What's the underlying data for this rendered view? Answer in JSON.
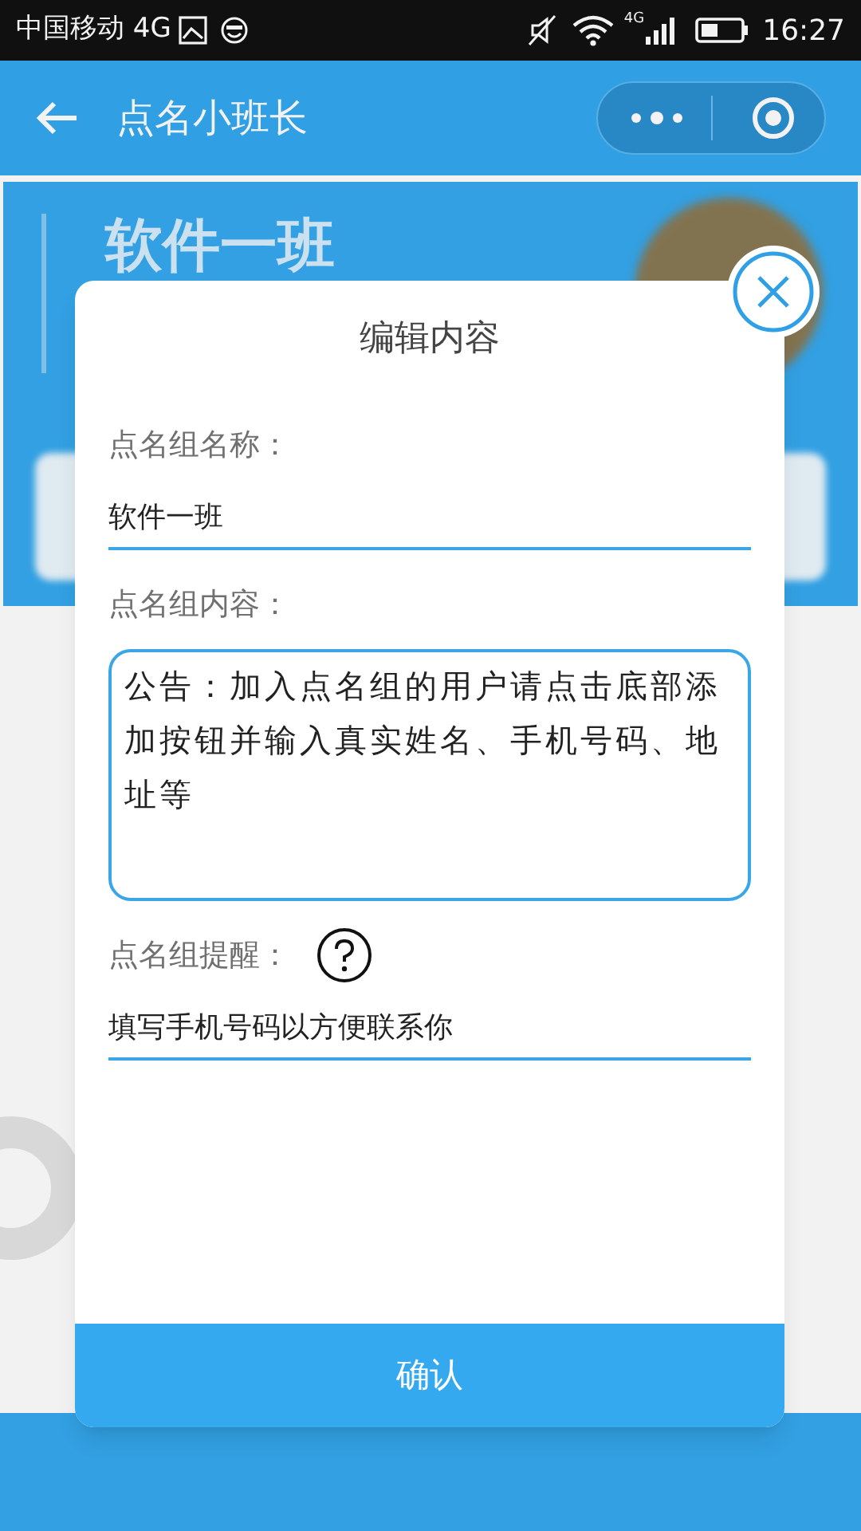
{
  "status_bar": {
    "carrier": "中国移动 4G",
    "network_badge": "4G",
    "time": "16:27"
  },
  "nav_bar": {
    "title": "点名小班长"
  },
  "background_card": {
    "title": "软件一班"
  },
  "dialog": {
    "title": "编辑内容",
    "fields": [
      {
        "kind": "input",
        "label": "点名组名称：",
        "value": "软件一班",
        "help": false
      },
      {
        "kind": "textarea",
        "label": "点名组内容：",
        "value": "公告：加入点名组的用户请点击底部添加按钮并输入真实姓名、手机号码、地址等",
        "help": false
      },
      {
        "kind": "input",
        "label": "点名组提醒：",
        "value": "填写手机号码以方便联系你",
        "help": true
      }
    ],
    "confirm": "确认"
  }
}
